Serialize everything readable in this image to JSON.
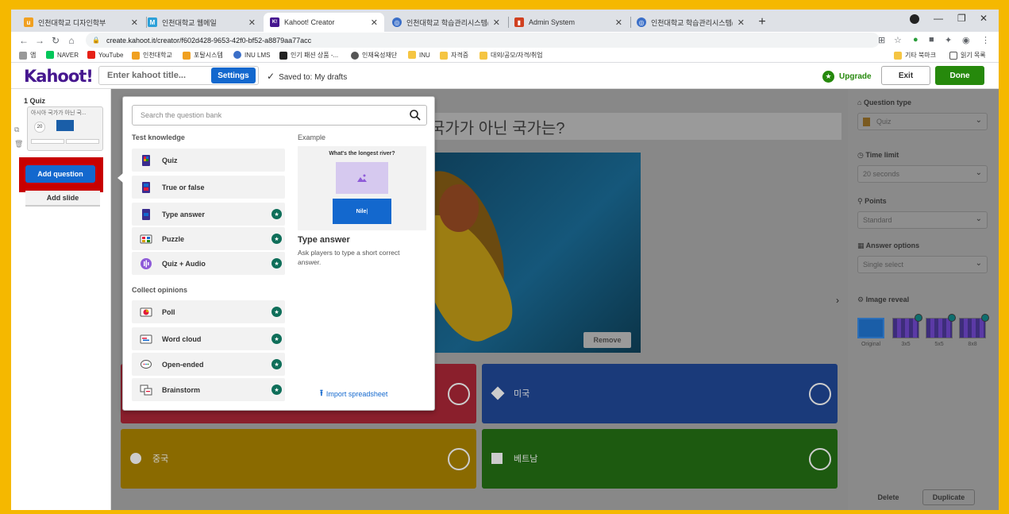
{
  "browser": {
    "tabs": [
      {
        "title": "인천대학교 디자인학부",
        "color": "#f0a020",
        "glyph": "u"
      },
      {
        "title": "인천대학교 웹메일",
        "color": "#2ca0d8",
        "glyph": "M"
      },
      {
        "title": "Kahoot! Creator",
        "color": "#46178f",
        "glyph": "K!"
      },
      {
        "title": "인천대학교 학습관리시스템(INU",
        "color": "#3b6fc8",
        "glyph": "◎"
      },
      {
        "title": "Admin System",
        "color": "#d04020",
        "glyph": "▮"
      },
      {
        "title": "인천대학교 학습관리시스템(INU",
        "color": "#3b6fc8",
        "glyph": "◎"
      }
    ],
    "new_tab": "+",
    "url": "create.kahoot.it/creator/f602d428-9653-42f0-bf52-a8879aa77acc",
    "bookmarks": [
      {
        "label": "앱",
        "color": "#999"
      },
      {
        "label": "NAVER",
        "color": "#03c75a"
      },
      {
        "label": "YouTube",
        "color": "#e62117"
      },
      {
        "label": "인천대학교",
        "color": "#f0a020"
      },
      {
        "label": "포탈시스템",
        "color": "#f0a020"
      },
      {
        "label": "INU LMS",
        "color": "#3b6fc8"
      },
      {
        "label": "인기 패션 상품 -...",
        "color": "#222"
      },
      {
        "label": "인재육성재단",
        "color": "#555"
      },
      {
        "label": "INU",
        "color": "#f5c542"
      },
      {
        "label": "자격증",
        "color": "#f5c542"
      },
      {
        "label": "대외/공모/자격/취업",
        "color": "#f5c542"
      }
    ],
    "bookmarks_right": [
      "기타 북마크",
      "읽기 목록"
    ]
  },
  "header": {
    "logo": "Kahoot!",
    "title_placeholder": "Enter kahoot title...",
    "settings_label": "Settings",
    "saved_text": "Saved to: My drafts",
    "upgrade_label": "Upgrade",
    "exit_label": "Exit",
    "done_label": "Done"
  },
  "sidebar": {
    "question_number": "1  Quiz",
    "thumb_title": "아시아 국가가 아닌 국...",
    "thumb_timer": "20",
    "add_question_label": "Add question",
    "add_slide_label": "Add slide"
  },
  "editor": {
    "question_text": "국가가 아닌 국가는?",
    "remove_label": "Remove",
    "answers": [
      {
        "text": "",
        "color": "#8a1f2c",
        "shape": "triangle"
      },
      {
        "text": "미국",
        "color": "#1a3a7a",
        "shape": "diamond"
      },
      {
        "text": "중국",
        "color": "#8a6a00",
        "shape": "circle"
      },
      {
        "text": "베트남",
        "color": "#1d5a10",
        "shape": "square"
      }
    ]
  },
  "right_panel": {
    "question_type_label": "Question type",
    "question_type_value": "Quiz",
    "time_limit_label": "Time limit",
    "time_limit_value": "20 seconds",
    "points_label": "Points",
    "points_value": "Standard",
    "answer_options_label": "Answer options",
    "answer_options_value": "Single select",
    "image_reveal_label": "Image reveal",
    "reveal_options": [
      "Original",
      "3x5",
      "5x5",
      "8x8"
    ],
    "delete_label": "Delete",
    "duplicate_label": "Duplicate"
  },
  "popup": {
    "search_placeholder": "Search the question bank",
    "section_test": "Test knowledge",
    "section_opinions": "Collect opinions",
    "test_items": [
      {
        "label": "Quiz",
        "premium": false
      },
      {
        "label": "True or false",
        "premium": false
      },
      {
        "label": "Type answer",
        "premium": true
      },
      {
        "label": "Puzzle",
        "premium": true
      },
      {
        "label": "Quiz + Audio",
        "premium": true
      }
    ],
    "opinion_items": [
      {
        "label": "Poll",
        "premium": true
      },
      {
        "label": "Word cloud",
        "premium": true
      },
      {
        "label": "Open-ended",
        "premium": true
      },
      {
        "label": "Brainstorm",
        "premium": true
      }
    ],
    "example_heading": "Example",
    "example_question": "What's the longest river?",
    "example_answer": "Nile",
    "example_title": "Type answer",
    "example_description": "Ask players to type a short correct answer.",
    "import_label": "Import spreadsheet"
  }
}
